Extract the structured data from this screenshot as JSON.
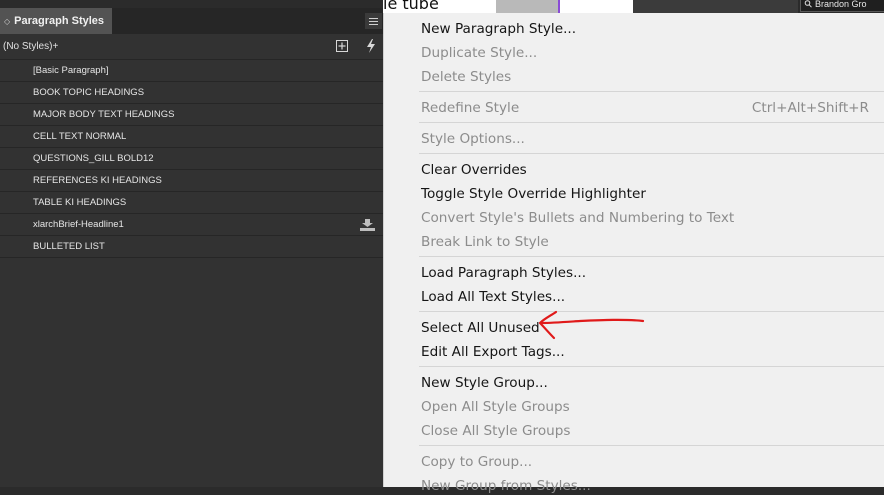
{
  "document": {
    "text_fragment": "le tube",
    "user_name": "Brandon Gro"
  },
  "panel": {
    "title": "Paragraph Styles",
    "current_style": "(No Styles)+",
    "styles": [
      "[Basic Paragraph]",
      "BOOK TOPIC HEADINGS",
      "MAJOR BODY TEXT HEADINGS",
      "CELL TEXT NORMAL",
      "QUESTIONS_GILL BOLD12",
      "REFERENCES KI HEADINGS",
      "TABLE KI HEADINGS",
      "xlarchBrief-Headline1",
      "BULLETED LIST"
    ]
  },
  "menu": {
    "items": [
      {
        "label": "New Paragraph Style...",
        "enabled": true
      },
      {
        "label": "Duplicate Style...",
        "enabled": false
      },
      {
        "label": "Delete Styles",
        "enabled": false
      },
      {
        "label": "Redefine Style",
        "shortcut": "Ctrl+Alt+Shift+R",
        "enabled": false
      },
      {
        "label": "Style Options...",
        "enabled": false
      },
      {
        "label": "Clear Overrides",
        "enabled": true
      },
      {
        "label": "Toggle Style Override Highlighter",
        "enabled": true
      },
      {
        "label": "Convert Style's Bullets and Numbering to Text",
        "enabled": false
      },
      {
        "label": "Break Link to Style",
        "enabled": false
      },
      {
        "label": "Load Paragraph Styles...",
        "enabled": true
      },
      {
        "label": "Load All Text Styles...",
        "enabled": true
      },
      {
        "label": "Select All Unused",
        "enabled": true
      },
      {
        "label": "Edit All Export Tags...",
        "enabled": true
      },
      {
        "label": "New Style Group...",
        "enabled": true
      },
      {
        "label": "Open All Style Groups",
        "enabled": false
      },
      {
        "label": "Close All Style Groups",
        "enabled": false
      },
      {
        "label": "Copy to Group...",
        "enabled": false
      },
      {
        "label": "New Group from Styles...",
        "enabled": false
      }
    ]
  },
  "colors": {
    "panel_bg": "#323232",
    "menu_bg": "#f0f0f0",
    "annotation_red": "#e01a1a"
  }
}
